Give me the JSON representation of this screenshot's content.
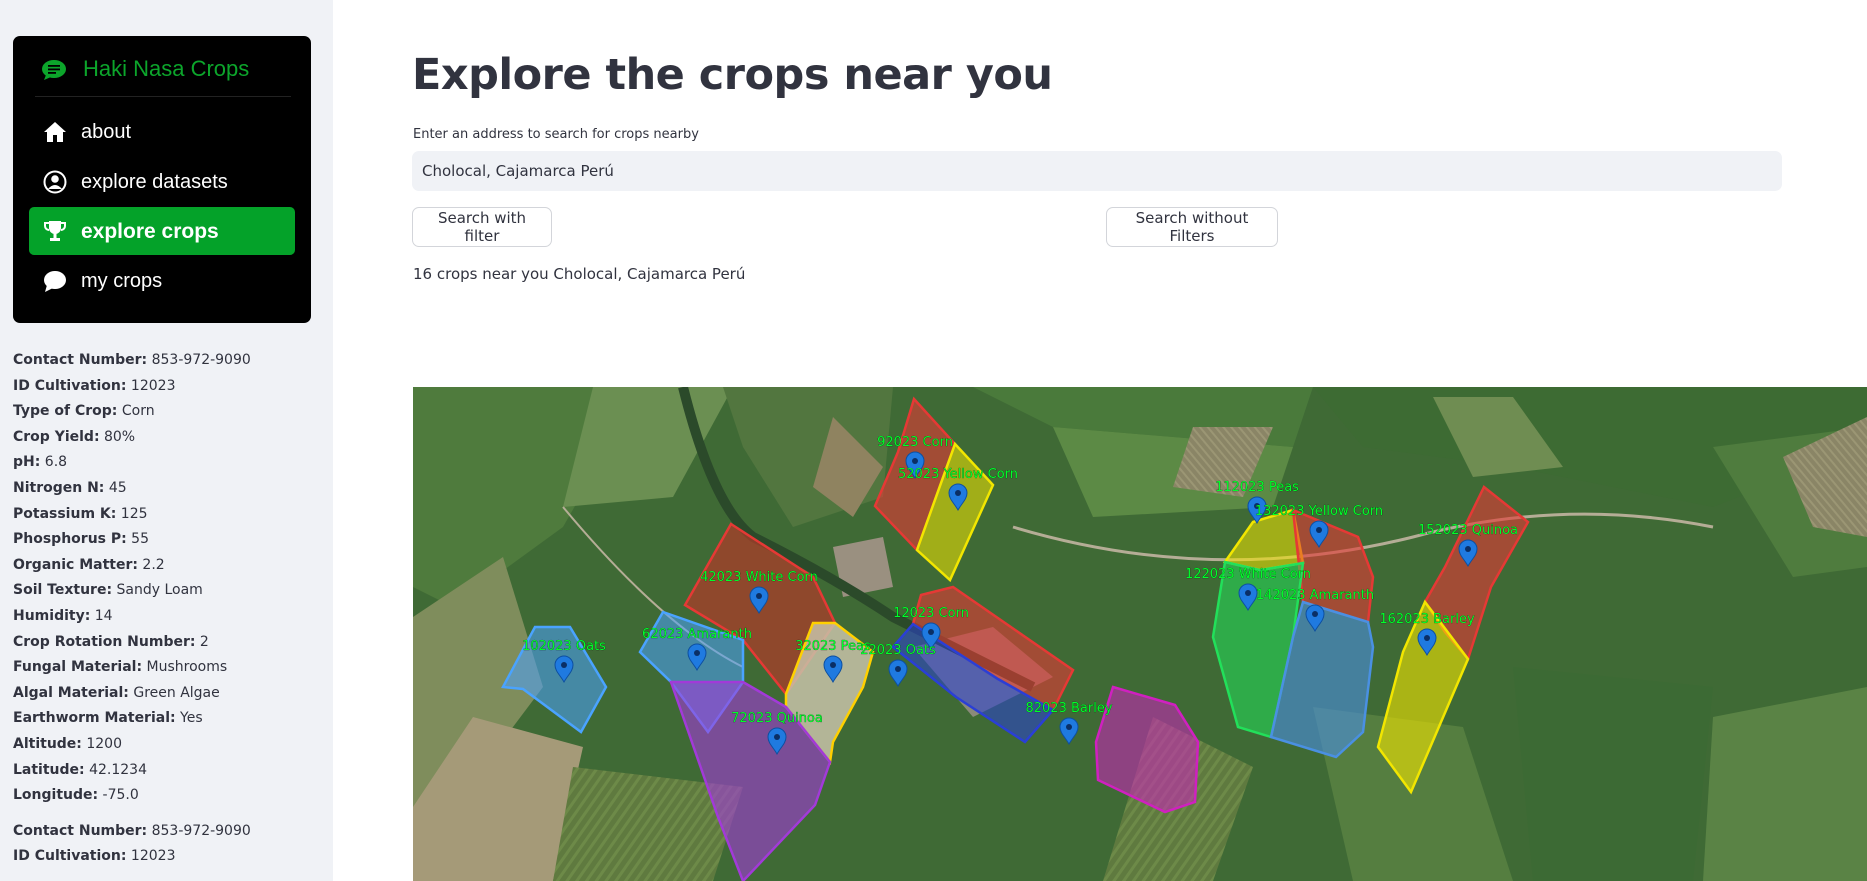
{
  "sidebar": {
    "app_title": "Haki Nasa Crops",
    "nav": [
      {
        "label": "about",
        "icon": "house-icon"
      },
      {
        "label": "explore datasets",
        "icon": "person-circle-icon"
      },
      {
        "label": "explore crops",
        "icon": "trophy-icon",
        "active": true
      },
      {
        "label": "my crops",
        "icon": "chat-icon"
      }
    ],
    "accent_color": "#04a229",
    "records": [
      [
        {
          "k": "Contact Number:",
          "v": "853-972-9090"
        },
        {
          "k": "ID Cultivation:",
          "v": "12023"
        },
        {
          "k": "Type of Crop:",
          "v": "Corn"
        },
        {
          "k": "Crop Yield:",
          "v": "80%"
        },
        {
          "k": "pH:",
          "v": "6.8"
        },
        {
          "k": "Nitrogen N:",
          "v": "45"
        },
        {
          "k": "Potassium K:",
          "v": "125"
        },
        {
          "k": "Phosphorus P:",
          "v": "55"
        },
        {
          "k": "Organic Matter:",
          "v": "2.2"
        },
        {
          "k": "Soil Texture:",
          "v": "Sandy Loam"
        },
        {
          "k": "Humidity:",
          "v": "14"
        },
        {
          "k": "Crop Rotation Number:",
          "v": "2"
        },
        {
          "k": "Fungal Material:",
          "v": "Mushrooms"
        },
        {
          "k": "Algal Material:",
          "v": "Green Algae"
        },
        {
          "k": "Earthworm Material:",
          "v": "Yes"
        },
        {
          "k": "Altitude:",
          "v": "1200"
        },
        {
          "k": "Latitude:",
          "v": "42.1234"
        },
        {
          "k": "Longitude:",
          "v": "-75.0"
        }
      ],
      [
        {
          "k": "Contact Number:",
          "v": "853-972-9090"
        },
        {
          "k": "ID Cultivation:",
          "v": "12023"
        }
      ]
    ]
  },
  "main": {
    "title": "Explore the crops near you",
    "search_label": "Enter an address to search for crops nearby",
    "search_value": "Cholocal, Cajamarca Perú",
    "btn_filter": "Search with filter",
    "btn_no_filter": "Search without Filters",
    "result_text": "16 crops near you Cholocal, Cajamarca Perú"
  },
  "map": {
    "plots": [
      {
        "label": "92023 Corn",
        "color": "#e53935"
      },
      {
        "label": "52023 Yellow Corn",
        "color": "#f2e600"
      },
      {
        "label": "42023 White Corn",
        "color": "#e53935"
      },
      {
        "label": "62023 Amaranth",
        "color": "#4aa3ff"
      },
      {
        "label": "32023 Peas",
        "color": "#ffd000"
      },
      {
        "label": "102023 Oats",
        "color": "#4aa3ff"
      },
      {
        "label": "72023 Quinoa",
        "color": "#a23ad8"
      },
      {
        "label": "12023 Corn",
        "color": "#e53935"
      },
      {
        "label": "22023 Oats",
        "color": "#2a3fd6"
      },
      {
        "label": "82023 Barley",
        "color": "#d020c0"
      },
      {
        "label": "112023 Peas",
        "color": "#f2e600"
      },
      {
        "label": "132023 Yellow Corn",
        "color": "#e53935"
      },
      {
        "label": "122023 White Corn",
        "color": "#22e05a"
      },
      {
        "label": "142023 Amaranth",
        "color": "#4a90e2"
      },
      {
        "label": "152023 Quinoa",
        "color": "#e53935"
      },
      {
        "label": "162023 Barley",
        "color": "#f2e600"
      }
    ]
  }
}
